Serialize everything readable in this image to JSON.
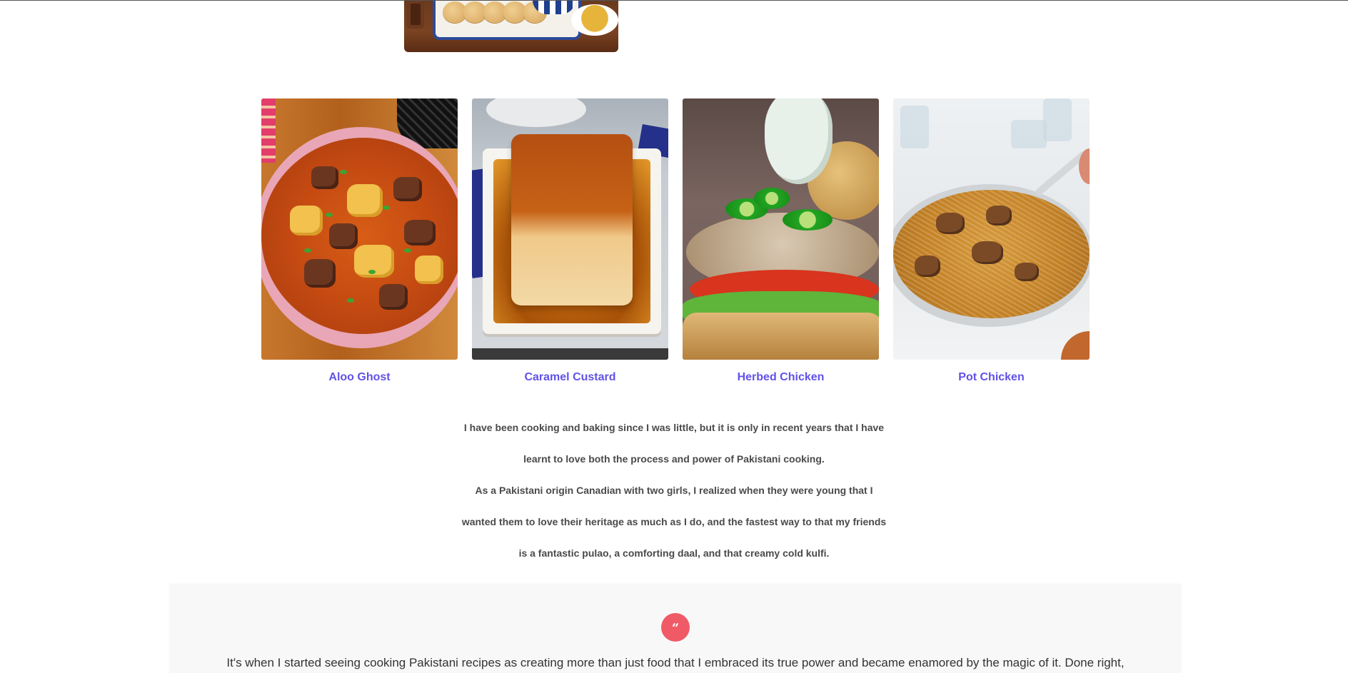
{
  "recipes": [
    {
      "title": "Aloo Ghost",
      "image_alt": "aloo-ghost-photo"
    },
    {
      "title": "Caramel Custard",
      "image_alt": "caramel-custard-photo"
    },
    {
      "title": "Herbed Chicken",
      "image_alt": "herbed-chicken-photo"
    },
    {
      "title": "Pot Chicken",
      "image_alt": "pot-chicken-photo"
    }
  ],
  "intro": {
    "line1": "I have been cooking and baking since I was little, but it is only in recent years that I have",
    "line2": "learnt to love both the process and power of Pakistani cooking.",
    "line3": "As a Pakistani origin Canadian with two girls, I realized when they were young that I",
    "line4": "wanted them to love their heritage as much as I do, and the fastest way to that my friends",
    "line5": "is a fantastic pulao, a comforting daal, and that creamy cold kulfi."
  },
  "quote": {
    "icon_glyph": "“",
    "text": "It's when I started seeing cooking Pakistani recipes as creating more than just food that I embraced its true power and became enamored by the magic of it. Done right,"
  },
  "colors": {
    "link": "#6152e8",
    "quote_accent": "#ef5a66",
    "body_text": "#4a4a4a"
  }
}
